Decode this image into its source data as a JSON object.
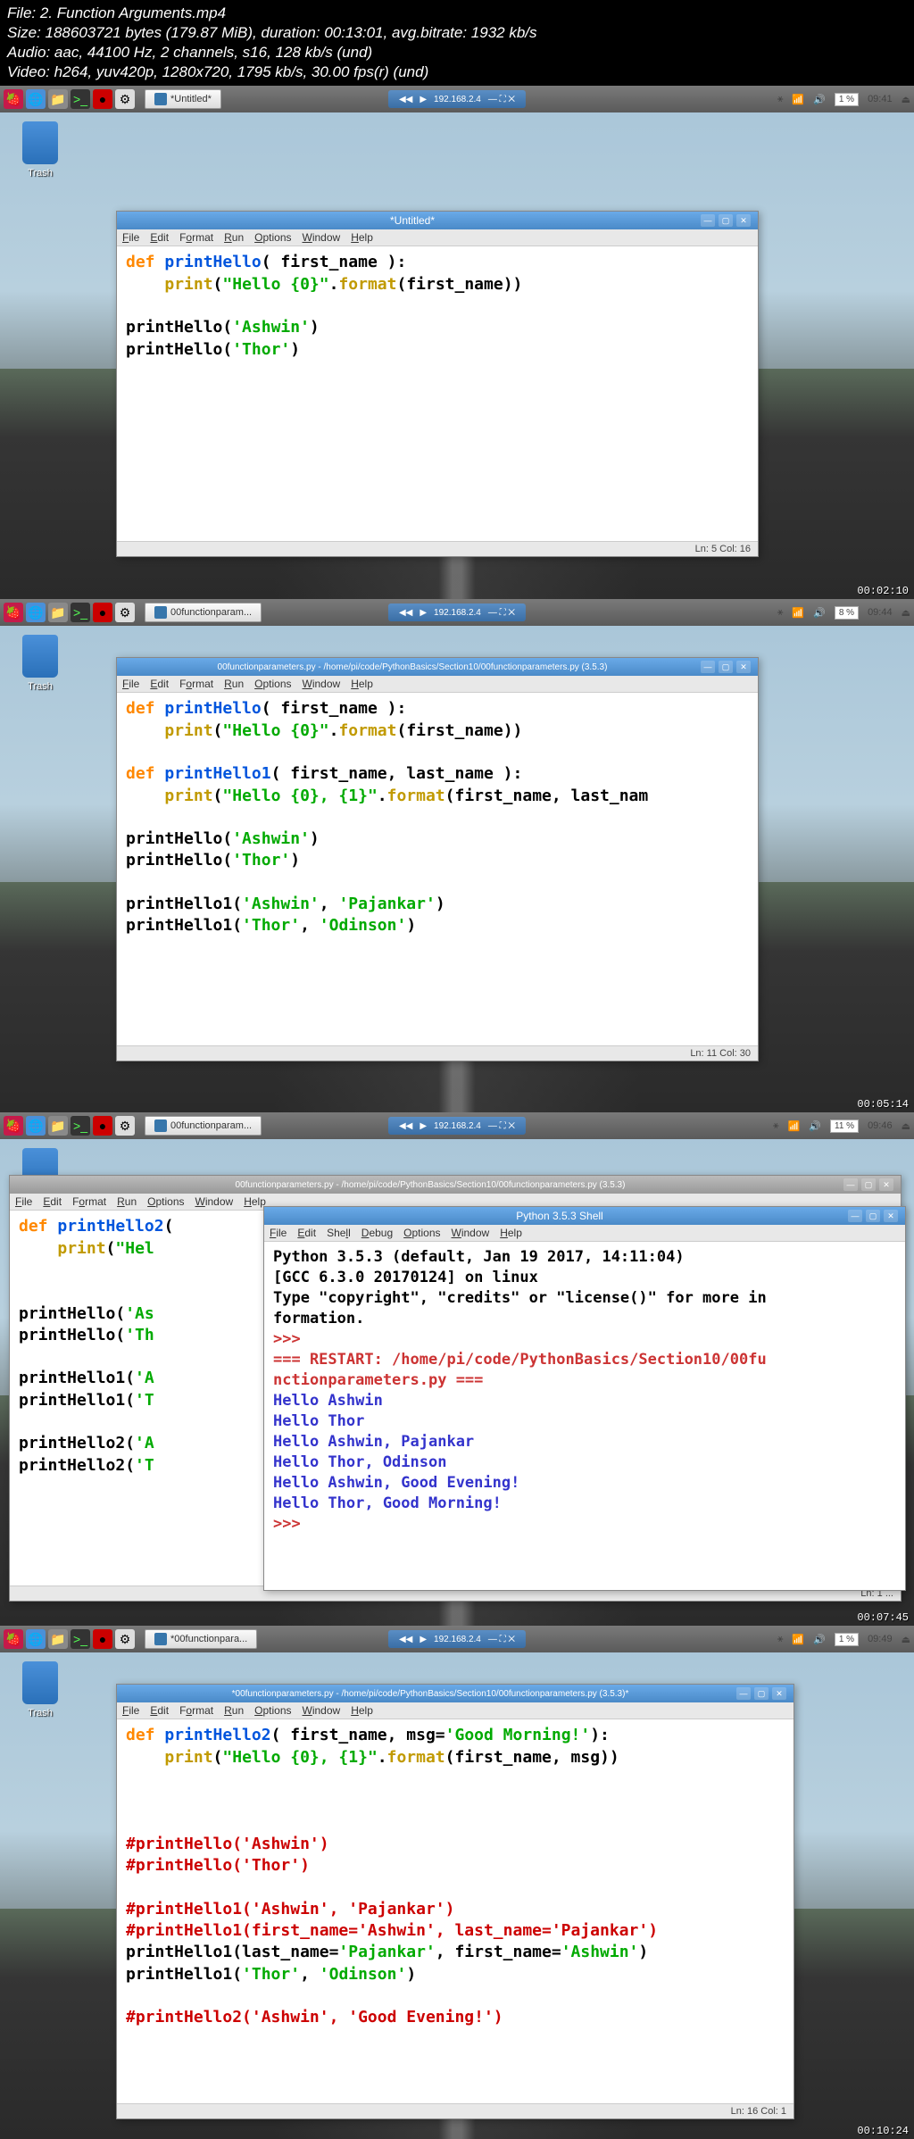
{
  "media": {
    "file": "File: 2. Function Arguments.mp4",
    "size": "Size: 188603721 bytes (179.87 MiB), duration: 00:13:01, avg.bitrate: 1932 kb/s",
    "audio": "Audio: aac, 44100 Hz, 2 channels, s16, 128 kb/s (und)",
    "video": "Video: h264, yuv420p, 1280x720, 1795 kb/s, 30.00 fps(r) (und)"
  },
  "menus": {
    "file": "File",
    "edit": "Edit",
    "format": "Format",
    "run": "Run",
    "options": "Options",
    "window": "Window",
    "help": "Help",
    "shell": "Shell",
    "debug": "Debug"
  },
  "trash": "Trash",
  "ip": "192.168.2.4",
  "f1": {
    "time": "09:41",
    "pct": "1 %",
    "tc": "00:02:10",
    "task": "*Untitled*",
    "title": "*Untitled*",
    "status": "Ln: 5  Col: 16",
    "code": {
      "l1a": "def ",
      "l1b": "printHello",
      "l1c": "( first_name ):",
      "l2a": "    ",
      "l2b": "print",
      "l2c": "(",
      "l2d": "\"Hello {0}\"",
      "l2e": ".",
      "l2f": "format",
      "l2g": "(first_name))",
      "l3": "",
      "l4a": "printHello(",
      "l4b": "'Ashwin'",
      "l4c": ")",
      "l5a": "printHello(",
      "l5b": "'Thor'",
      "l5c": ")"
    }
  },
  "f2": {
    "time": "09:44",
    "pct": "8 %",
    "tc": "00:05:14",
    "task": "00functionparam...",
    "title": "00functionparameters.py - /home/pi/code/PythonBasics/Section10/00functionparameters.py (3.5.3)",
    "status": "Ln: 11  Col: 30",
    "code": {
      "l1a": "def ",
      "l1b": "printHello",
      "l1c": "( first_name ):",
      "l2a": "    ",
      "l2b": "print",
      "l2c": "(",
      "l2d": "\"Hello {0}\"",
      "l2e": ".",
      "l2f": "format",
      "l2g": "(first_name))",
      "l3": "",
      "l4a": "def ",
      "l4b": "printHello1",
      "l4c": "( first_name, last_name ):",
      "l5a": "    ",
      "l5b": "print",
      "l5c": "(",
      "l5d": "\"Hello {0}, {1}\"",
      "l5e": ".",
      "l5f": "format",
      "l5g": "(first_name, last_nam",
      "l6": "",
      "l7a": "printHello(",
      "l7b": "'Ashwin'",
      "l7c": ")",
      "l8a": "printHello(",
      "l8b": "'Thor'",
      "l8c": ")",
      "l9": "",
      "l10a": "printHello1(",
      "l10b": "'Ashwin'",
      "l10c": ", ",
      "l10d": "'Pajankar'",
      "l10e": ")",
      "l11a": "printHello1(",
      "l11b": "'Thor'",
      "l11c": ", ",
      "l11d": "'Odinson'",
      "l11e": ")"
    }
  },
  "f3": {
    "time": "09:46",
    "pct": "11 %",
    "tc": "00:07:45",
    "task": "00functionparam...",
    "title": "00functionparameters.py - /home/pi/code/PythonBasics/Section10/00functionparameters.py (3.5.3)",
    "shell_title": "Python 3.5.3 Shell",
    "status": "Ln: 1  ...",
    "code": {
      "l1a": "def ",
      "l1b": "printHello2",
      "l1c": "(",
      "l2a": "    ",
      "l2b": "print",
      "l2c": "(",
      "l2d": "\"Hel",
      "l3": "",
      "l4": "",
      "l5a": "printHello(",
      "l5b": "'As",
      "l6a": "printHello(",
      "l6b": "'Th",
      "l7": "",
      "l8a": "printHello1(",
      "l8b": "'A",
      "l9a": "printHello1(",
      "l9b": "'T",
      "l10": "",
      "l11a": "printHello2(",
      "l11b": "'A",
      "l12a": "printHello2(",
      "l12b": "'T"
    },
    "shell": {
      "l1": "Python 3.5.3 (default, Jan 19 2017, 14:11:04)",
      "l2": "[GCC 6.3.0 20170124] on linux",
      "l3": "Type \"copyright\", \"credits\" or \"license()\" for more in",
      "l4": "formation.",
      "p1": ">>> ",
      "l5": "=== RESTART: /home/pi/code/PythonBasics/Section10/00fu",
      "l6": "nctionparameters.py ===",
      "l7": "Hello Ashwin",
      "l8": "Hello Thor",
      "l9": "Hello Ashwin, Pajankar",
      "l10": "Hello Thor, Odinson",
      "l11": "Hello Ashwin, Good Evening!",
      "l12": "Hello Thor, Good Morning!",
      "p2": ">>> "
    }
  },
  "f4": {
    "time": "09:49",
    "pct": "1 %",
    "tc": "00:10:24",
    "task": "*00functionpara...",
    "title": "*00functionparameters.py - /home/pi/code/PythonBasics/Section10/00functionparameters.py (3.5.3)*",
    "status": "Ln: 16  Col: 1",
    "code": {
      "l1a": "def ",
      "l1b": "printHello2",
      "l1c": "( first_name, msg=",
      "l1d": "'Good Morning!'",
      "l1e": "):",
      "l2a": "    ",
      "l2b": "print",
      "l2c": "(",
      "l2d": "\"Hello {0}, {1}\"",
      "l2e": ".",
      "l2f": "format",
      "l2g": "(first_name, msg))",
      "l3": "",
      "l4": "",
      "l5": "",
      "l6": "#printHello('Ashwin')",
      "l7": "#printHello('Thor')",
      "l8": "",
      "l9": "#printHello1('Ashwin', 'Pajankar')",
      "l10": "#printHello1(first_name='Ashwin', last_name='Pajankar')",
      "l11a": "printHello1(last_name=",
      "l11b": "'Pajankar'",
      "l11c": ", first_name=",
      "l11d": "'Ashwin'",
      "l11e": ")",
      "l12a": "printHello1(",
      "l12b": "'Thor'",
      "l12c": ", ",
      "l12d": "'Odinson'",
      "l12e": ")",
      "l13": "",
      "l14": "#printHello2('Ashwin', 'Good Evening!')"
    }
  }
}
